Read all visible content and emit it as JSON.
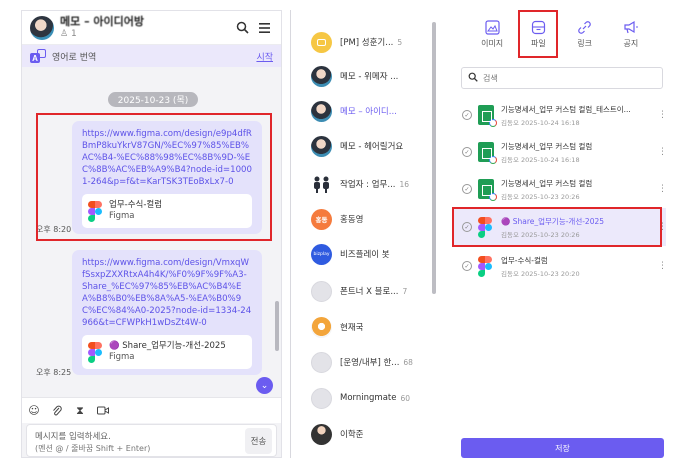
{
  "chat": {
    "room_title": "메모 – 아이디어방",
    "member_count": "1",
    "translate_label": "영어로 번역",
    "translate_start": "시작",
    "date_divider": "2025-10-23 (목)",
    "messages": [
      {
        "link": "https://www.figma.com/design/e9p4dfRBmP8kuYkrV87GN/%EC%97%85%EB%AC%B4-%EC%88%98%EC%8B%9D-%EC%8B%AC%EB%A9%B4?node-id=10001-264&p=f&t=KarTSK3TEoBxLx7-0",
        "card_title": "업무-수식-컬럼",
        "card_sub": "Figma",
        "time": "오후 8:20"
      },
      {
        "link": "https://www.figma.com/design/VmxqWfSsxpZXXRtxA4h4K/%F0%9F%9F%A3-Share_%EC%97%85%EB%AC%B4%EA%B8%B0%EB%8A%A5-%EA%B0%9C%EC%84%A0-2025?node-id=1334-24966&t=CFWPkH1wDsZt4W-0",
        "card_title": "🟣 Share_업무기능-개선-2025",
        "card_sub": "Figma",
        "time": "오후 8:25"
      }
    ],
    "composer_placeholder": "메시지를 입력하세요.",
    "composer_hint": "(멘션 @ / 줄바꿈 Shift + Enter)",
    "send_label": "전송"
  },
  "rooms": [
    {
      "name": "[PM] 성훈기...",
      "count": "5",
      "avatar": "yellow"
    },
    {
      "name": "메모 - 위메자 ...",
      "count": "",
      "avatar": "photo"
    },
    {
      "name": "메모 – 아이디...",
      "count": "",
      "avatar": "photo",
      "active": true
    },
    {
      "name": "메모 - 헤어릴거요",
      "count": "",
      "avatar": "photo"
    },
    {
      "name": "작업자 : 업무...",
      "count": "16",
      "avatar": "people"
    },
    {
      "name": "홍동영",
      "count": "",
      "avatar": "orange",
      "avatar_text": "홍동"
    },
    {
      "name": "비즈플레이 봇",
      "count": "",
      "avatar": "blue",
      "avatar_text": "bizplay"
    },
    {
      "name": "폰트너 X 블로...",
      "count": "7",
      "avatar": "grey"
    },
    {
      "name": "현재국",
      "count": "",
      "avatar": "cat"
    },
    {
      "name": "[운영/내부] 한...",
      "count": "68",
      "avatar": "grey"
    },
    {
      "name": "Morningmate",
      "count": "60",
      "avatar": "grey"
    },
    {
      "name": "이학준",
      "count": "",
      "avatar": "dark"
    }
  ],
  "files": {
    "tabs": [
      {
        "label": "이미지",
        "icon": "image-icon"
      },
      {
        "label": "파일",
        "icon": "file-icon",
        "active": true
      },
      {
        "label": "링크",
        "icon": "link-icon"
      },
      {
        "label": "공지",
        "icon": "megaphone-icon"
      }
    ],
    "search_placeholder": "검색",
    "items": [
      {
        "name": "기능명세서_업무 커스텀 컬럼_테스트이...",
        "meta": "김동오 2025-10-24 16:18",
        "type": "sheet"
      },
      {
        "name": "기능명세서_업무 커스텀 컬럼",
        "meta": "김동오 2025-10-24 16:18",
        "type": "sheet"
      },
      {
        "name": "기능명세서_업무 커스텀 컬럼",
        "meta": "김동오 2025-10-23 20:26",
        "type": "sheet"
      },
      {
        "name": "🟣 Share_업무기능-개선-2025",
        "meta": "김동오 2025-10-23 20:26",
        "type": "figma",
        "selected": true
      },
      {
        "name": "업무-수식-컬럼",
        "meta": "김동오 2025-10-23 20:20",
        "type": "figma"
      }
    ],
    "save_label": "저장"
  },
  "colors": {
    "accent": "#6b5cf0",
    "highlight": "#e0262a",
    "bubble": "#e4e2fb"
  }
}
